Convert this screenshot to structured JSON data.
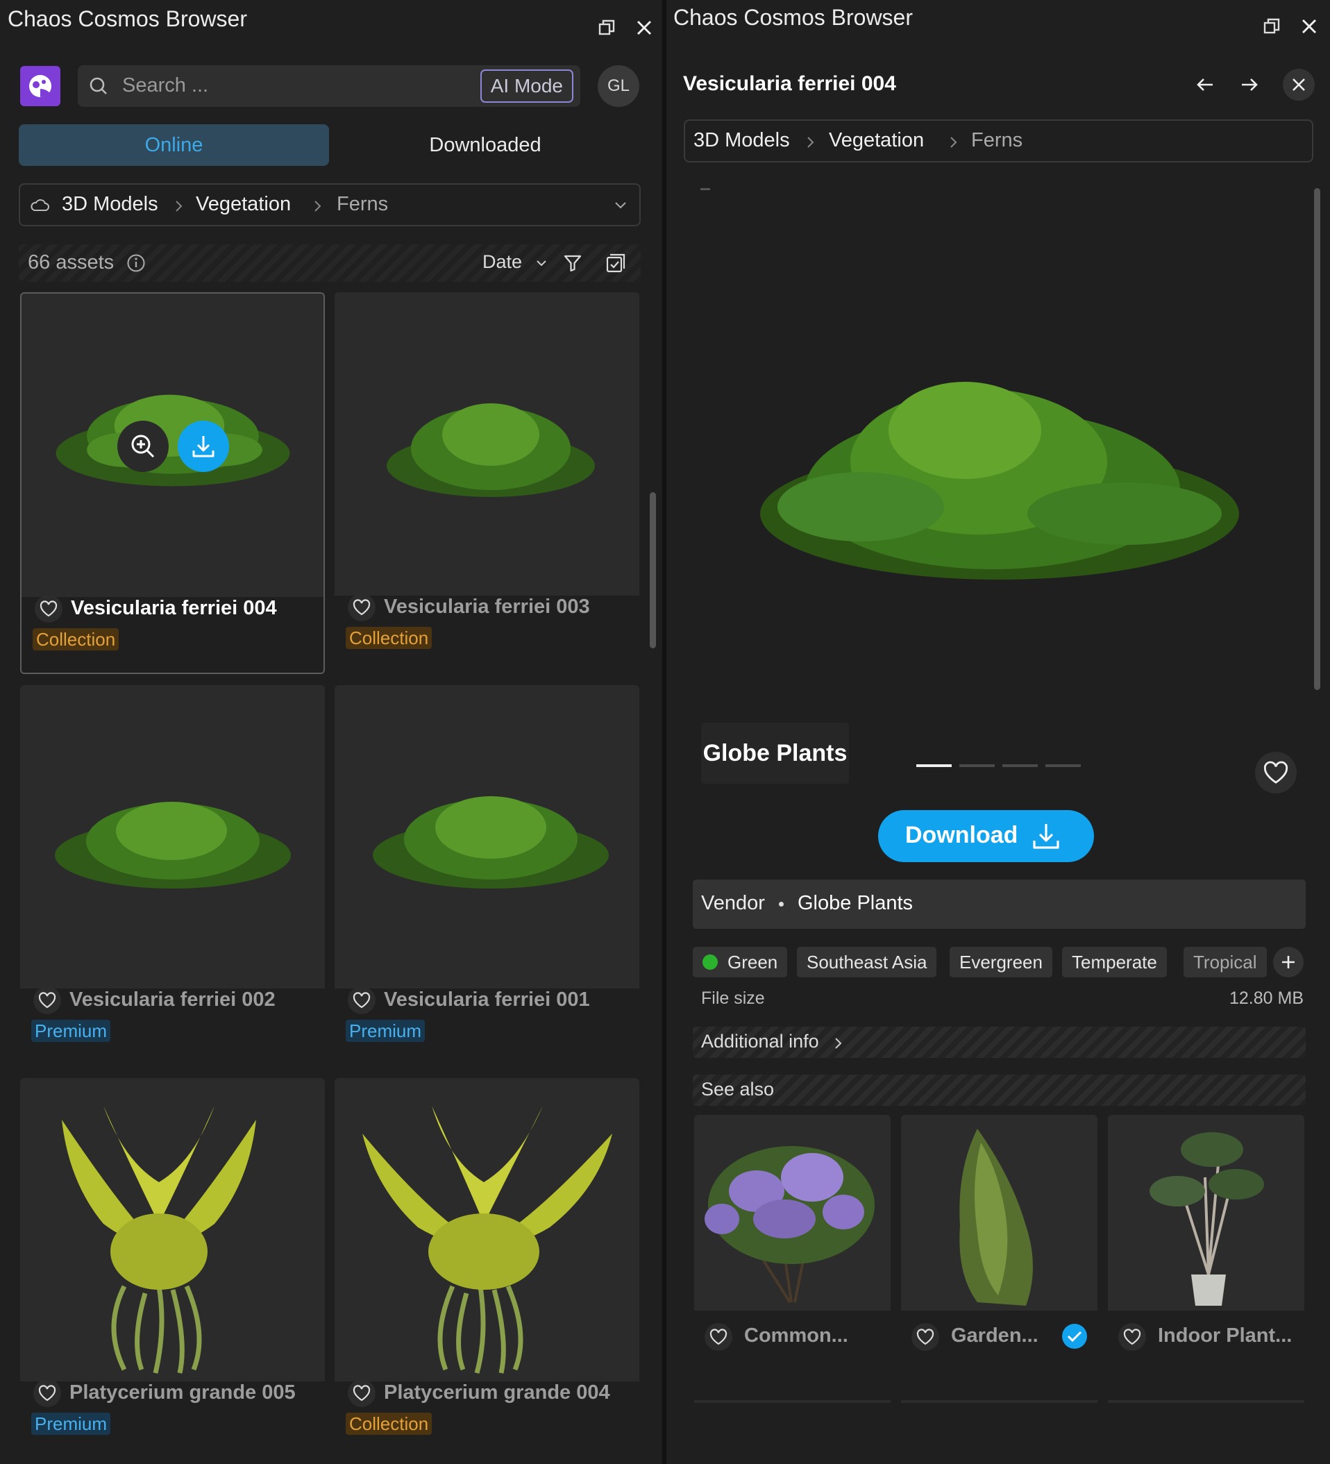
{
  "left_window": {
    "title": "Chaos Cosmos Browser",
    "search": {
      "placeholder": "Search ...",
      "ai_mode_label": "AI Mode"
    },
    "avatar_initials": "GL",
    "tabs": [
      {
        "label": "Online",
        "active": true
      },
      {
        "label": "Downloaded",
        "active": false
      }
    ],
    "breadcrumb": [
      "3D Models",
      "Vegetation",
      "Ferns"
    ],
    "asset_count": "66 assets",
    "sort_label": "Date",
    "assets": [
      {
        "name": "Vesicularia ferriei 004",
        "badge": "Collection",
        "selected": true
      },
      {
        "name": "Vesicularia ferriei 003",
        "badge": "Collection"
      },
      {
        "name": "Vesicularia ferriei 002",
        "badge": "Premium"
      },
      {
        "name": "Vesicularia ferriei 001",
        "badge": "Premium"
      },
      {
        "name": "Platycerium grande 005",
        "badge": "Premium"
      },
      {
        "name": "Platycerium grande 004",
        "badge": "Collection"
      }
    ]
  },
  "right_window": {
    "title": "Chaos Cosmos Browser",
    "asset_title": "Vesicularia ferriei 004",
    "breadcrumb": [
      "3D Models",
      "Vegetation",
      "Ferns"
    ],
    "brand_logo": "Globe Plants",
    "carousel": {
      "slides": 4,
      "active": 1
    },
    "download_label": "Download",
    "vendor_label": "Vendor",
    "vendor_name": "Globe Plants",
    "tags": [
      "Green",
      "Southeast Asia",
      "Evergreen",
      "Temperate",
      "Tropical"
    ],
    "file_size_label": "File size",
    "file_size_value": "12.80 MB",
    "additional_info_label": "Additional info",
    "see_also_label": "See also",
    "see_also": [
      {
        "name": "Common...",
        "downloaded": false
      },
      {
        "name": "Garden...",
        "downloaded": true
      },
      {
        "name": "Indoor Plant...",
        "downloaded": false
      }
    ]
  },
  "colors": {
    "accent": "#12a3ee",
    "collection": "#e2a13a",
    "premium": "#4ab0ee",
    "brand": "#7e3dd6"
  }
}
